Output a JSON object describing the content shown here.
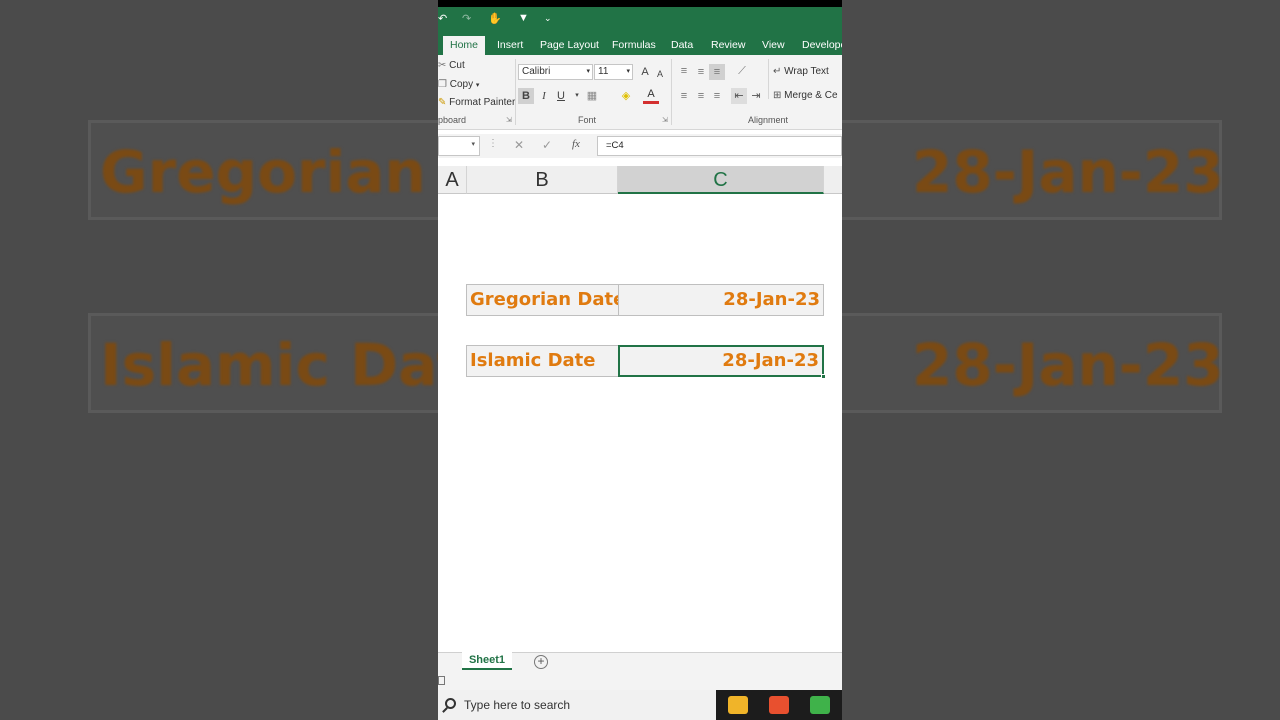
{
  "background": {
    "label_1": "Gregorian D",
    "value_1": "28-Jan-23",
    "label_2": "Islamic Dat",
    "value_2": "28-Jan-23"
  },
  "quick_access": {
    "overflow": "⌄"
  },
  "ribbon_tabs": [
    {
      "label": "Home"
    },
    {
      "label": "Insert"
    },
    {
      "label": "Page Layout"
    },
    {
      "label": "Formulas"
    },
    {
      "label": "Data"
    },
    {
      "label": "Review"
    },
    {
      "label": "View"
    },
    {
      "label": "Develope"
    }
  ],
  "clipboard": {
    "cut": "Cut",
    "copy": "Copy",
    "format_painter": "Format Painter",
    "group": "pboard"
  },
  "font": {
    "name": "Calibri",
    "size": "11",
    "grow": "A",
    "shrink": "A",
    "bold": "B",
    "italic": "I",
    "underline": "U",
    "font_color": "A",
    "group": "Font"
  },
  "alignment": {
    "wrap_text": "Wrap Text",
    "merge": "Merge & Ce",
    "group": "Alignment"
  },
  "formula_bar": {
    "cancel": "✕",
    "enter": "✓",
    "fx": "fx",
    "formula": "=C4"
  },
  "columns": [
    {
      "label": "A"
    },
    {
      "label": "B"
    },
    {
      "label": "C"
    }
  ],
  "cells": {
    "r1_label": "Gregorian Date",
    "r1_value": "28-Jan-23",
    "r2_label": "Islamic Date",
    "r2_value": "28-Jan-23"
  },
  "sheets": {
    "active": "Sheet1",
    "add": "+"
  },
  "taskbar": {
    "search_placeholder": "Type here to search"
  },
  "colors": {
    "excel_green": "#217346",
    "cell_text": "#e07b10"
  }
}
